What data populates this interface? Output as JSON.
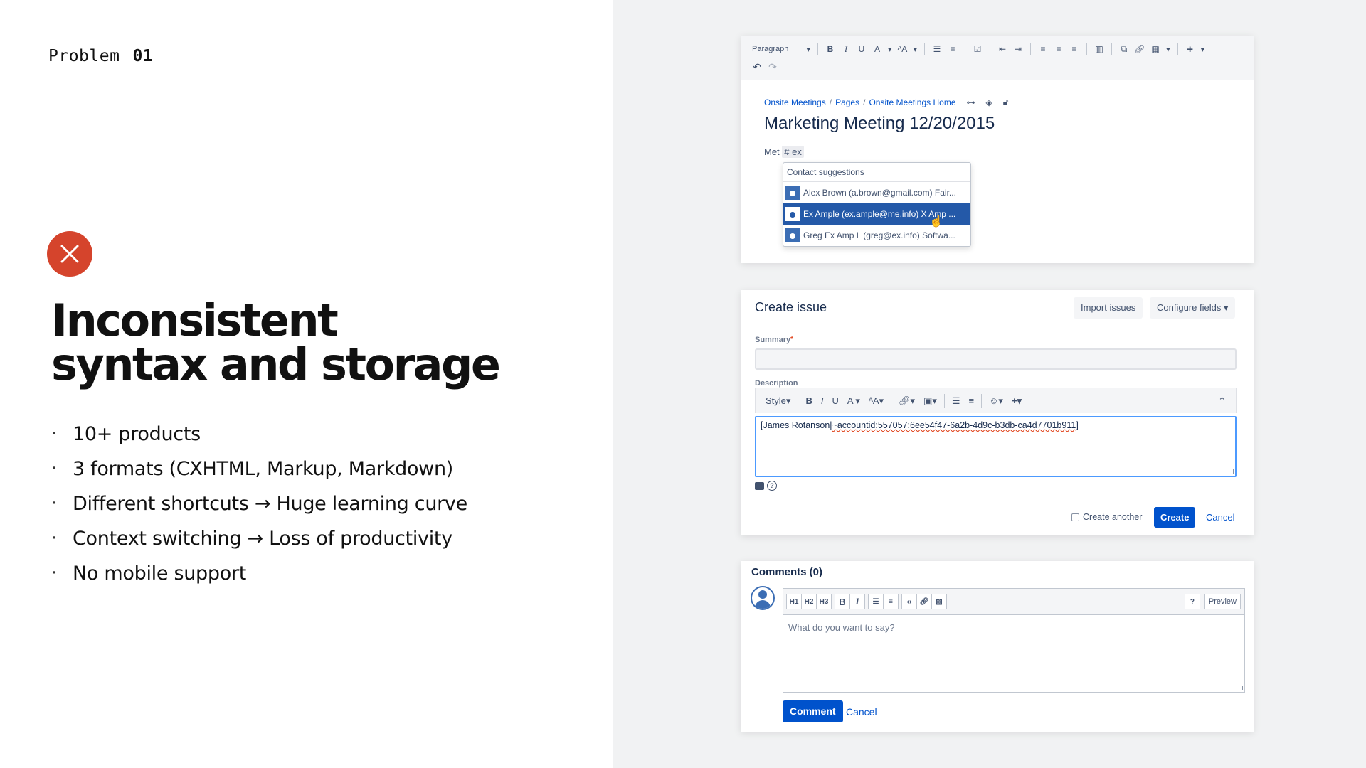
{
  "slide": {
    "eyebrow_label": "Problem",
    "eyebrow_number": "01",
    "headline_line1": "Inconsistent",
    "headline_line2": "syntax and storage",
    "bullets": [
      "10+ products",
      "3 formats (CXHTML, Markup, Markdown)",
      "Different shortcuts → Huge learning curve",
      "Context switching → Loss of productivity",
      "No mobile support"
    ],
    "accent_color": "#d5442c"
  },
  "editor": {
    "paragraph_select": "Paragraph",
    "breadcrumbs": [
      "Onsite Meetings",
      "Pages",
      "Onsite Meetings Home"
    ],
    "page_title": "Marketing Meeting 12/20/2015",
    "body_prefix": "Met",
    "mention_text": "# ex",
    "suggestions_header": "Contact suggestions",
    "suggestions": [
      "Alex Brown (a.brown@gmail.com) Fair...",
      "Ex Ample (ex.ample@me.info) X Amp ...",
      "Greg Ex Amp L (greg@ex.info) Softwa..."
    ]
  },
  "create_issue": {
    "title": "Create issue",
    "import_button": "Import issues",
    "configure_button": "Configure fields",
    "summary_label": "Summary",
    "description_label": "Description",
    "style_label": "Style",
    "description_value_prefix": "[James Rotanson|",
    "description_value_underlined": "~accountid:557057:6ee54f47-6a2b-4d9c-b3db-ca4d7701b911",
    "description_value_suffix": "]",
    "create_another_label": "Create another",
    "create_button": "Create",
    "cancel_link": "Cancel"
  },
  "comments": {
    "title": "Comments (0)",
    "toolbar_headings": [
      "H1",
      "H2",
      "H3"
    ],
    "preview_button": "Preview",
    "placeholder": "What do you want to say?",
    "comment_button": "Comment",
    "cancel_link": "Cancel"
  }
}
